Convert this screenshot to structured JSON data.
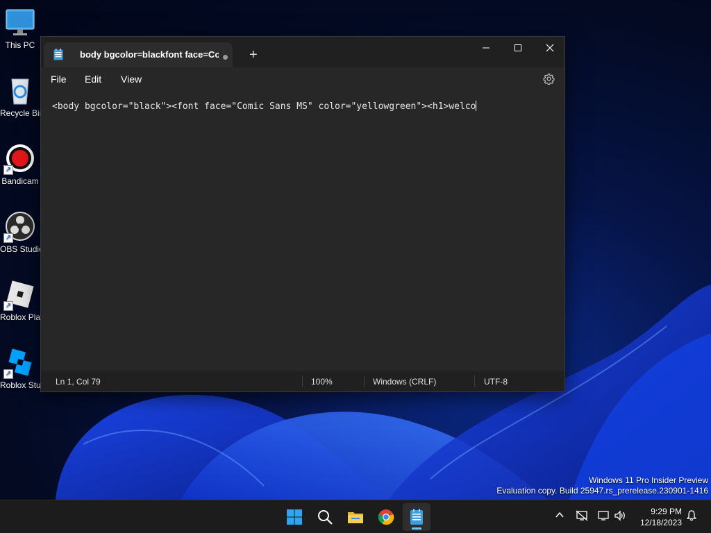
{
  "desktop": {
    "icons": [
      {
        "label": "This PC",
        "icon": "monitor-icon"
      },
      {
        "label": "Recycle Bin",
        "icon": "recycle-bin-icon"
      },
      {
        "label": "Bandicam",
        "icon": "bandicam-icon"
      },
      {
        "label": "OBS Studio",
        "icon": "obs-icon"
      },
      {
        "label": "Roblox Player",
        "icon": "roblox-player-icon"
      },
      {
        "label": "Roblox Studio",
        "icon": "roblox-studio-icon"
      }
    ],
    "watermark": {
      "line1": "Windows 11 Pro Insider Preview",
      "line2": "Evaluation copy. Build 25947.rs_prerelease.230901-1416"
    }
  },
  "notepad": {
    "tab_title": "body bgcolor=blackfont face=Comic Sans MS color=yellowgreen",
    "new_tab_label": "+",
    "menu": {
      "file": "File",
      "edit": "Edit",
      "view": "View"
    },
    "content": "<body bgcolor=\"black\"><font face=\"Comic Sans MS\" color=\"yellowgreen\"><h1>welco",
    "status": {
      "position": "Ln 1, Col 79",
      "zoom": "100%",
      "line_ending": "Windows (CRLF)",
      "encoding": "UTF-8"
    }
  },
  "taskbar": {
    "apps": [
      "start-icon",
      "search-icon",
      "file-explorer-icon",
      "chrome-icon",
      "notepad-icon"
    ],
    "clock": {
      "time": "9:29 PM",
      "date": "12/18/2023"
    }
  },
  "colors": {
    "accent": "#60cdff",
    "window_bg": "#272727",
    "titlebar_bg": "#202020",
    "taskbar_bg": "#1c1c1c"
  }
}
